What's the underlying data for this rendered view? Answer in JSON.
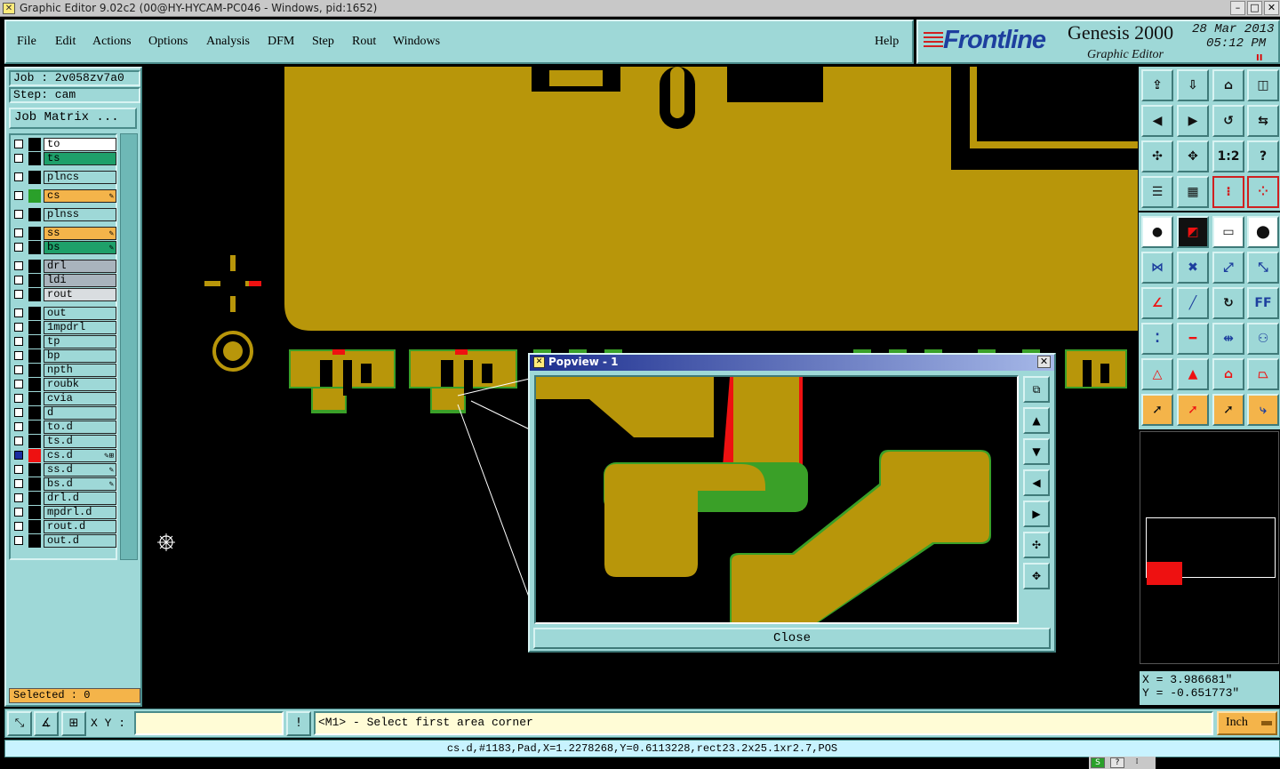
{
  "window": {
    "title": "Graphic Editor 9.02c2 (00@HY-HYCAM-PC046 - Windows, pid:1652)"
  },
  "menu": {
    "items": [
      {
        "label": "File"
      },
      {
        "label": "Edit"
      },
      {
        "label": "Actions"
      },
      {
        "label": "Options"
      },
      {
        "label": "Analysis"
      },
      {
        "label": "DFM"
      },
      {
        "label": "Step"
      },
      {
        "label": "Rout"
      },
      {
        "label": "Windows"
      }
    ],
    "help": "Help"
  },
  "brand": {
    "logo": "Frontline",
    "product": "Genesis 2000",
    "subtitle": "Graphic Editor",
    "date": "28 Mar 2013",
    "time": "05:12 PM",
    "pause_glyph": "II"
  },
  "job": {
    "job_label": "Job : 2v058zv7a0",
    "step_label": "Step: cam",
    "matrix_button": "Job Matrix ..."
  },
  "layers": [
    {
      "name": "to",
      "color": "#ffffff",
      "swatch": "#000000",
      "checked": false,
      "flag": ""
    },
    {
      "name": "ts",
      "color": "#1ea06a",
      "swatch": "#000000",
      "checked": false,
      "flag": ""
    },
    {
      "name": "plncs",
      "color": "#9ed8d7",
      "swatch": "#000000",
      "checked": false,
      "flag": ""
    },
    {
      "name": "cs",
      "color": "#f4b44a",
      "swatch": "#2aa02a",
      "checked": false,
      "flag": "✎"
    },
    {
      "name": "plnss",
      "color": "#9ed8d7",
      "swatch": "#000000",
      "checked": false,
      "flag": ""
    },
    {
      "name": "ss",
      "color": "#f4b44a",
      "swatch": "#000000",
      "checked": false,
      "flag": "✎"
    },
    {
      "name": "bs",
      "color": "#1ea06a",
      "swatch": "#000000",
      "checked": false,
      "flag": "✎"
    },
    {
      "name": "drl",
      "color": "#a9b4bd",
      "swatch": "#000000",
      "checked": false,
      "flag": ""
    },
    {
      "name": "ldi",
      "color": "#a9b4bd",
      "swatch": "#000000",
      "checked": false,
      "flag": ""
    },
    {
      "name": "rout",
      "color": "#d9dde0",
      "swatch": "#000000",
      "checked": false,
      "flag": ""
    },
    {
      "name": "out",
      "color": "#9ed8d7",
      "swatch": "#000000",
      "checked": false,
      "flag": ""
    },
    {
      "name": "1mpdrl",
      "color": "#9ed8d7",
      "swatch": "#000000",
      "checked": false,
      "flag": ""
    },
    {
      "name": "tp",
      "color": "#9ed8d7",
      "swatch": "#000000",
      "checked": false,
      "flag": ""
    },
    {
      "name": "bp",
      "color": "#9ed8d7",
      "swatch": "#000000",
      "checked": false,
      "flag": ""
    },
    {
      "name": "npth",
      "color": "#9ed8d7",
      "swatch": "#000000",
      "checked": false,
      "flag": ""
    },
    {
      "name": "roubk",
      "color": "#9ed8d7",
      "swatch": "#000000",
      "checked": false,
      "flag": ""
    },
    {
      "name": "cvia",
      "color": "#9ed8d7",
      "swatch": "#000000",
      "checked": false,
      "flag": ""
    },
    {
      "name": "d",
      "color": "#9ed8d7",
      "swatch": "#000000",
      "checked": false,
      "flag": ""
    },
    {
      "name": "to.d",
      "color": "#9ed8d7",
      "swatch": "#000000",
      "checked": false,
      "flag": ""
    },
    {
      "name": "ts.d",
      "color": "#9ed8d7",
      "swatch": "#000000",
      "checked": false,
      "flag": ""
    },
    {
      "name": "cs.d",
      "color": "#9ed8d7",
      "swatch": "#ee1111",
      "checked": true,
      "flag": "✎⊞"
    },
    {
      "name": "ss.d",
      "color": "#9ed8d7",
      "swatch": "#000000",
      "checked": false,
      "flag": "✎"
    },
    {
      "name": "bs.d",
      "color": "#9ed8d7",
      "swatch": "#000000",
      "checked": false,
      "flag": "✎"
    },
    {
      "name": "drl.d",
      "color": "#9ed8d7",
      "swatch": "#000000",
      "checked": false,
      "flag": ""
    },
    {
      "name": "mpdrl.d",
      "color": "#9ed8d7",
      "swatch": "#000000",
      "checked": false,
      "flag": ""
    },
    {
      "name": "rout.d",
      "color": "#9ed8d7",
      "swatch": "#000000",
      "checked": false,
      "flag": ""
    },
    {
      "name": "out.d",
      "color": "#9ed8d7",
      "swatch": "#000000",
      "checked": false,
      "flag": ""
    }
  ],
  "selected": "Selected : 0",
  "coords": {
    "x": "X = 3.986681\"",
    "y": "Y = -0.651773\""
  },
  "command": {
    "xy_label": "X Y :",
    "xy_value": "",
    "prompt": "<M1> - Select first area corner",
    "units": "Inch"
  },
  "status": {
    "text": "cs.d,#1183,Pad,X=1.2278268,Y=0.6113228,rect23.2x25.1xr2.7,POS"
  },
  "popview": {
    "title": "Popview - 1",
    "close_label": "Close"
  },
  "tools": {
    "ratio_label": "1:2",
    "help_label": "?",
    "ff_label": "FF"
  },
  "colors": {
    "copper": "#b8960a",
    "panel": "#9ed8d7",
    "highlight": "#ee1111",
    "edge_green": "#3aa028"
  },
  "icons": [
    "cursor-icon",
    "zoom-icon",
    "home-icon",
    "snap-icon",
    "measure-icon",
    "select-icon"
  ]
}
